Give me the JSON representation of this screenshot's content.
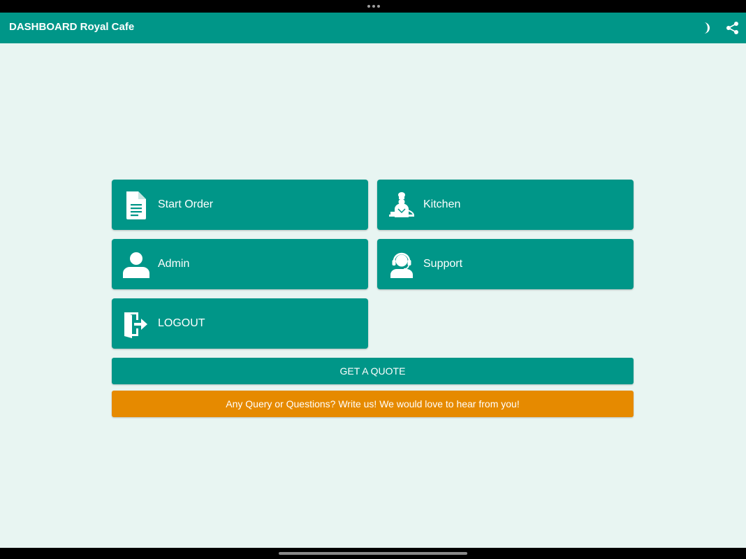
{
  "app": {
    "title": "DASHBOARD Royal Cafe",
    "theme_color": "#009688",
    "background_color": "#e8f5f2",
    "accent_color": "#e68a00"
  },
  "appbar": {
    "actions": [
      {
        "icon": "dark-mode-icon"
      },
      {
        "icon": "share-icon"
      }
    ]
  },
  "tiles": [
    {
      "label": "Start Order",
      "icon": "document-icon"
    },
    {
      "label": "Kitchen",
      "icon": "chef-icon"
    },
    {
      "label": "Admin",
      "icon": "person-icon"
    },
    {
      "label": "Support",
      "icon": "headset-icon"
    },
    {
      "label": "LOGOUT",
      "icon": "logout-icon"
    }
  ],
  "buttons": {
    "quote_label": "GET A QUOTE",
    "query_label": "Any Query or Questions? Write us! We would love to hear from you!"
  }
}
